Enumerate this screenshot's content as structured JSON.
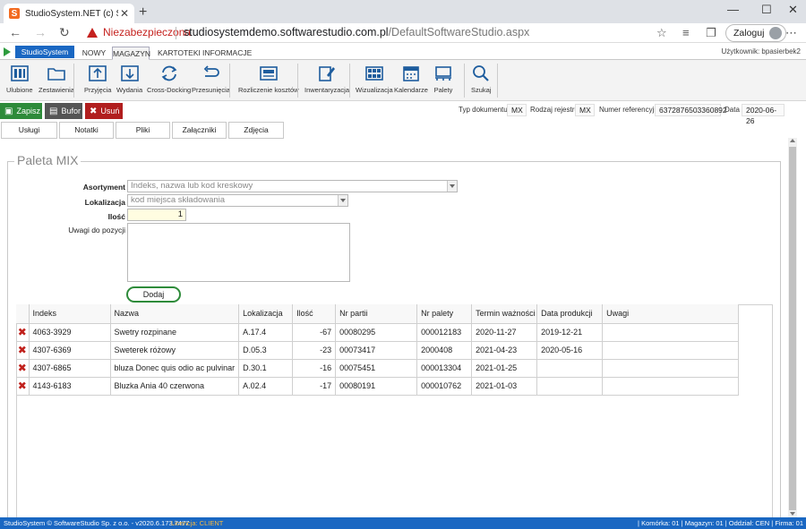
{
  "browser": {
    "tab_title": "StudioSystem.NET (c) SoftwareStudio",
    "tab_fav": "S",
    "new_tab": "+",
    "win_min": "—",
    "win_max": "☐",
    "win_close": "✕",
    "tab_close": "✕",
    "nav_back": "←",
    "nav_fwd": "→",
    "nav_reload": "↻",
    "security": "Niezabezpieczona",
    "url_host": "studiosystemdemo.softwarestudio.com.pl",
    "url_path": "/DefaultSoftwareStudio.aspx",
    "login": "Zaloguj",
    "star": "☆",
    "more": "⋯"
  },
  "app": {
    "brand": "StudioSystem",
    "tabs": [
      "NOWY",
      "MAGAZYN",
      "KARTOTEKI",
      "INFORMACJE"
    ],
    "user": "Użytkownik: bpasierbek2"
  },
  "ribbon": [
    {
      "label": "Ulubione",
      "icon": "favorites-icon"
    },
    {
      "label": "Zestawienia",
      "icon": "folder-icon"
    },
    {
      "label": "Przyjęcia",
      "icon": "receive-icon"
    },
    {
      "label": "Wydania",
      "icon": "issue-icon"
    },
    {
      "label": "Cross-Docking",
      "icon": "crossdock-icon"
    },
    {
      "label": "Przesunięcia",
      "icon": "move-icon"
    },
    {
      "label": "Rozliczenie kosztów",
      "icon": "cost-icon"
    },
    {
      "label": "Inwentaryzacja",
      "icon": "inventory-icon"
    },
    {
      "label": "Wizualizacja",
      "icon": "visual-icon"
    },
    {
      "label": "Kalendarze",
      "icon": "calendar-icon"
    },
    {
      "label": "Palety",
      "icon": "pallet-icon"
    },
    {
      "label": "Szukaj",
      "icon": "search-icon"
    }
  ],
  "toolbar": {
    "save": "Zapisz",
    "buffer": "Bufor",
    "delete": "Usuń",
    "doc_type_label": "Typ dokumentu",
    "doc_type": "MX",
    "register_label": "Rodzaj rejestru",
    "register": "MX",
    "ref_label": "Numer referencyjny",
    "ref": "6372876503360892",
    "date_label": "Data",
    "date": "2020-06-26"
  },
  "subtabs": [
    "Usługi",
    "Notatki",
    "Pliki",
    "Załączniki",
    "Zdjęcia"
  ],
  "form": {
    "legend": "Paleta MIX",
    "assortment_label": "Asortyment",
    "assortment_placeholder": "Indeks, nazwa lub kod kreskowy",
    "location_label": "Lokalizacja",
    "location_placeholder": "kod miejsca składowania",
    "qty_label": "Ilość",
    "qty": "1",
    "notes_label": "Uwagi do pozycji",
    "add": "Dodaj"
  },
  "grid": {
    "columns": [
      "Indeks",
      "Nazwa",
      "Lokalizacja",
      "Ilość",
      "Nr partii",
      "Nr palety",
      "Termin ważności",
      "Data produkcji",
      "Uwagi"
    ],
    "rows": [
      [
        "4063-3929",
        "Swetry rozpinane",
        "A.17.4",
        "-67",
        "00080295",
        "000012183",
        "2020-11-27",
        "2019-12-21",
        ""
      ],
      [
        "4307-6369",
        "Sweterek różowy",
        "D.05.3",
        "-23",
        "00073417",
        "2000408",
        "2021-04-23",
        "2020-05-16",
        ""
      ],
      [
        "4307-6865",
        "bluza Donec quis odio ac pulvinar",
        "D.30.1",
        "-16",
        "00075451",
        "000013304",
        "2021-01-25",
        "",
        ""
      ],
      [
        "4143-6183",
        "Bluzka Ania 40 czerwona",
        "A.02.4",
        "-17",
        "00080191",
        "000010762",
        "2021-01-03",
        "",
        ""
      ]
    ]
  },
  "footer": {
    "left": "StudioSystem © SoftwareStudio Sp. z o.o. - v2020.6.173.7477",
    "license": "Licencja: CLIENT",
    "right": "| Komórka: 01 | Magazyn: 01 | Oddział: CEN | Firma: 01"
  }
}
